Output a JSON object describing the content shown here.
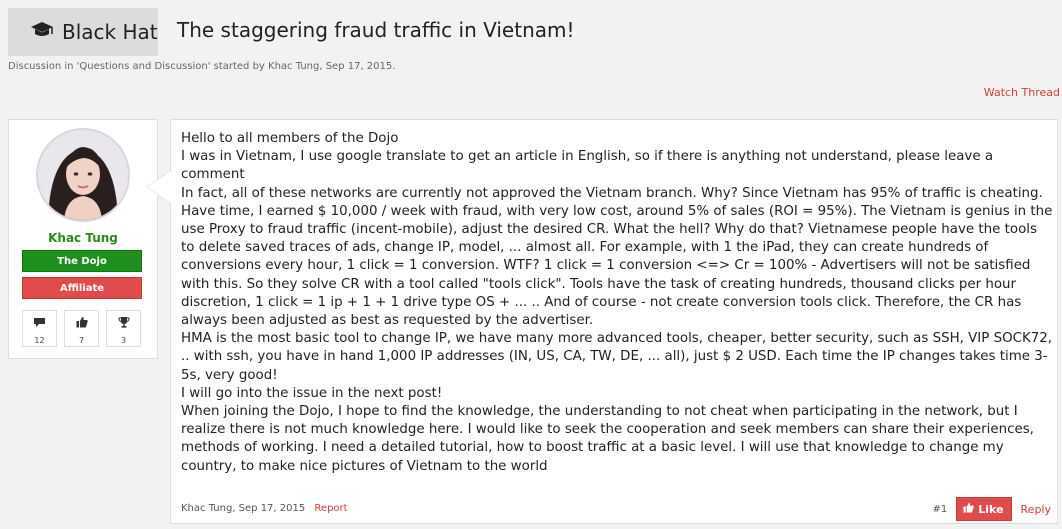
{
  "thread": {
    "prefix": "Black Hat",
    "title": "The staggering fraud traffic in Vietnam!",
    "meta": "Discussion in 'Questions and Discussion' started by Khac Tung, Sep 17, 2015.",
    "watch_label": "Watch Thread"
  },
  "user": {
    "name": "Khac Tung",
    "badge1": "The Dojo",
    "badge2": "Affiliate",
    "stats": [
      {
        "icon": "speech-bubble-icon",
        "value": "12"
      },
      {
        "icon": "thumbs-up-icon",
        "value": "7"
      },
      {
        "icon": "trophy-icon",
        "value": "3"
      }
    ]
  },
  "post": {
    "lines": [
      "Hello to all members of the Dojo",
      "I was in Vietnam, I use google translate to get an article in English, so if there is anything not understand, please leave a comment",
      "In fact, all of these networks are currently not approved the Vietnam branch. Why? Since Vietnam has 95% of traffic is cheating. Have time, I earned $ 10,000 / week with fraud, with very low cost, around 5% of sales (ROI = 95%). The Vietnam is genius in the use Proxy to fraud traffic (incent-mobile), adjust the desired CR. What the hell? Why do that? Vietnamese people have the tools to delete saved traces of ads, change IP, model, ... almost all. For example, with 1 the iPad, they can create hundreds of conversions every hour, 1 click = 1 conversion. WTF? 1 click = 1 conversion <=> Cr = 100% - Advertisers will not be satisfied with this. So they solve CR with a tool called \"tools click\". Tools have the task of creating hundreds, thousand clicks per hour discretion, 1 click = 1 ip + 1 + 1 drive type OS + ... .. And of course - not create conversion tools click. Therefore, the CR has always been adjusted as best as requested by the advertiser.",
      "HMA is the most basic tool to change IP, we have many more advanced tools, cheaper, better security, such as SSH, VIP SOCK72, .. with ssh, you have in hand 1,000 IP addresses (IN, US, CA, TW, DE, ... all), just $ 2 USD. Each time the IP changes takes time 3-5s, very good!",
      "I will go into the issue in the next post!",
      "When joining the Dojo, I hope to find the knowledge, the understanding to not cheat when participating in the network, but I realize there is not much knowledge here. I would like to seek the cooperation and seek members can share their experiences, methods of working. I need a detailed tutorial, how to boost traffic at a basic level. I will use that knowledge to change my country, to make nice pictures of Vietnam to the world"
    ],
    "author_date": "Khac Tung, Sep 17, 2015",
    "report_label": "Report",
    "post_number": "#1",
    "like_label": "Like",
    "reply_label": "Reply"
  },
  "colors": {
    "accent_red": "#e04b4b",
    "accent_green": "#1c8f1c",
    "link_red": "#d33c3c"
  }
}
